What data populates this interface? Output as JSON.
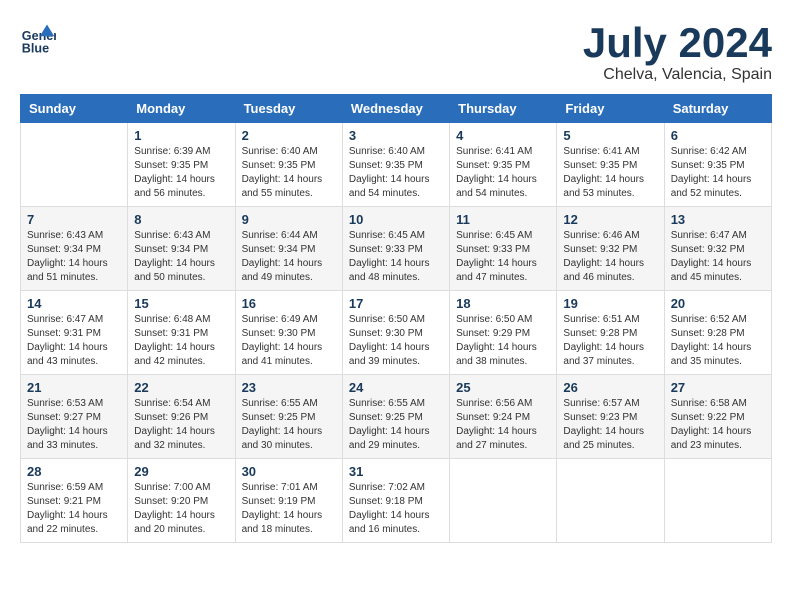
{
  "logo": {
    "line1": "General",
    "line2": "Blue"
  },
  "title": "July 2024",
  "subtitle": "Chelva, Valencia, Spain",
  "weekdays": [
    "Sunday",
    "Monday",
    "Tuesday",
    "Wednesday",
    "Thursday",
    "Friday",
    "Saturday"
  ],
  "weeks": [
    [
      {
        "day": "",
        "sunrise": "",
        "sunset": "",
        "daylight": ""
      },
      {
        "day": "1",
        "sunrise": "Sunrise: 6:39 AM",
        "sunset": "Sunset: 9:35 PM",
        "daylight": "Daylight: 14 hours and 56 minutes."
      },
      {
        "day": "2",
        "sunrise": "Sunrise: 6:40 AM",
        "sunset": "Sunset: 9:35 PM",
        "daylight": "Daylight: 14 hours and 55 minutes."
      },
      {
        "day": "3",
        "sunrise": "Sunrise: 6:40 AM",
        "sunset": "Sunset: 9:35 PM",
        "daylight": "Daylight: 14 hours and 54 minutes."
      },
      {
        "day": "4",
        "sunrise": "Sunrise: 6:41 AM",
        "sunset": "Sunset: 9:35 PM",
        "daylight": "Daylight: 14 hours and 54 minutes."
      },
      {
        "day": "5",
        "sunrise": "Sunrise: 6:41 AM",
        "sunset": "Sunset: 9:35 PM",
        "daylight": "Daylight: 14 hours and 53 minutes."
      },
      {
        "day": "6",
        "sunrise": "Sunrise: 6:42 AM",
        "sunset": "Sunset: 9:35 PM",
        "daylight": "Daylight: 14 hours and 52 minutes."
      }
    ],
    [
      {
        "day": "7",
        "sunrise": "Sunrise: 6:43 AM",
        "sunset": "Sunset: 9:34 PM",
        "daylight": "Daylight: 14 hours and 51 minutes."
      },
      {
        "day": "8",
        "sunrise": "Sunrise: 6:43 AM",
        "sunset": "Sunset: 9:34 PM",
        "daylight": "Daylight: 14 hours and 50 minutes."
      },
      {
        "day": "9",
        "sunrise": "Sunrise: 6:44 AM",
        "sunset": "Sunset: 9:34 PM",
        "daylight": "Daylight: 14 hours and 49 minutes."
      },
      {
        "day": "10",
        "sunrise": "Sunrise: 6:45 AM",
        "sunset": "Sunset: 9:33 PM",
        "daylight": "Daylight: 14 hours and 48 minutes."
      },
      {
        "day": "11",
        "sunrise": "Sunrise: 6:45 AM",
        "sunset": "Sunset: 9:33 PM",
        "daylight": "Daylight: 14 hours and 47 minutes."
      },
      {
        "day": "12",
        "sunrise": "Sunrise: 6:46 AM",
        "sunset": "Sunset: 9:32 PM",
        "daylight": "Daylight: 14 hours and 46 minutes."
      },
      {
        "day": "13",
        "sunrise": "Sunrise: 6:47 AM",
        "sunset": "Sunset: 9:32 PM",
        "daylight": "Daylight: 14 hours and 45 minutes."
      }
    ],
    [
      {
        "day": "14",
        "sunrise": "Sunrise: 6:47 AM",
        "sunset": "Sunset: 9:31 PM",
        "daylight": "Daylight: 14 hours and 43 minutes."
      },
      {
        "day": "15",
        "sunrise": "Sunrise: 6:48 AM",
        "sunset": "Sunset: 9:31 PM",
        "daylight": "Daylight: 14 hours and 42 minutes."
      },
      {
        "day": "16",
        "sunrise": "Sunrise: 6:49 AM",
        "sunset": "Sunset: 9:30 PM",
        "daylight": "Daylight: 14 hours and 41 minutes."
      },
      {
        "day": "17",
        "sunrise": "Sunrise: 6:50 AM",
        "sunset": "Sunset: 9:30 PM",
        "daylight": "Daylight: 14 hours and 39 minutes."
      },
      {
        "day": "18",
        "sunrise": "Sunrise: 6:50 AM",
        "sunset": "Sunset: 9:29 PM",
        "daylight": "Daylight: 14 hours and 38 minutes."
      },
      {
        "day": "19",
        "sunrise": "Sunrise: 6:51 AM",
        "sunset": "Sunset: 9:28 PM",
        "daylight": "Daylight: 14 hours and 37 minutes."
      },
      {
        "day": "20",
        "sunrise": "Sunrise: 6:52 AM",
        "sunset": "Sunset: 9:28 PM",
        "daylight": "Daylight: 14 hours and 35 minutes."
      }
    ],
    [
      {
        "day": "21",
        "sunrise": "Sunrise: 6:53 AM",
        "sunset": "Sunset: 9:27 PM",
        "daylight": "Daylight: 14 hours and 33 minutes."
      },
      {
        "day": "22",
        "sunrise": "Sunrise: 6:54 AM",
        "sunset": "Sunset: 9:26 PM",
        "daylight": "Daylight: 14 hours and 32 minutes."
      },
      {
        "day": "23",
        "sunrise": "Sunrise: 6:55 AM",
        "sunset": "Sunset: 9:25 PM",
        "daylight": "Daylight: 14 hours and 30 minutes."
      },
      {
        "day": "24",
        "sunrise": "Sunrise: 6:55 AM",
        "sunset": "Sunset: 9:25 PM",
        "daylight": "Daylight: 14 hours and 29 minutes."
      },
      {
        "day": "25",
        "sunrise": "Sunrise: 6:56 AM",
        "sunset": "Sunset: 9:24 PM",
        "daylight": "Daylight: 14 hours and 27 minutes."
      },
      {
        "day": "26",
        "sunrise": "Sunrise: 6:57 AM",
        "sunset": "Sunset: 9:23 PM",
        "daylight": "Daylight: 14 hours and 25 minutes."
      },
      {
        "day": "27",
        "sunrise": "Sunrise: 6:58 AM",
        "sunset": "Sunset: 9:22 PM",
        "daylight": "Daylight: 14 hours and 23 minutes."
      }
    ],
    [
      {
        "day": "28",
        "sunrise": "Sunrise: 6:59 AM",
        "sunset": "Sunset: 9:21 PM",
        "daylight": "Daylight: 14 hours and 22 minutes."
      },
      {
        "day": "29",
        "sunrise": "Sunrise: 7:00 AM",
        "sunset": "Sunset: 9:20 PM",
        "daylight": "Daylight: 14 hours and 20 minutes."
      },
      {
        "day": "30",
        "sunrise": "Sunrise: 7:01 AM",
        "sunset": "Sunset: 9:19 PM",
        "daylight": "Daylight: 14 hours and 18 minutes."
      },
      {
        "day": "31",
        "sunrise": "Sunrise: 7:02 AM",
        "sunset": "Sunset: 9:18 PM",
        "daylight": "Daylight: 14 hours and 16 minutes."
      },
      {
        "day": "",
        "sunrise": "",
        "sunset": "",
        "daylight": ""
      },
      {
        "day": "",
        "sunrise": "",
        "sunset": "",
        "daylight": ""
      },
      {
        "day": "",
        "sunrise": "",
        "sunset": "",
        "daylight": ""
      }
    ]
  ]
}
